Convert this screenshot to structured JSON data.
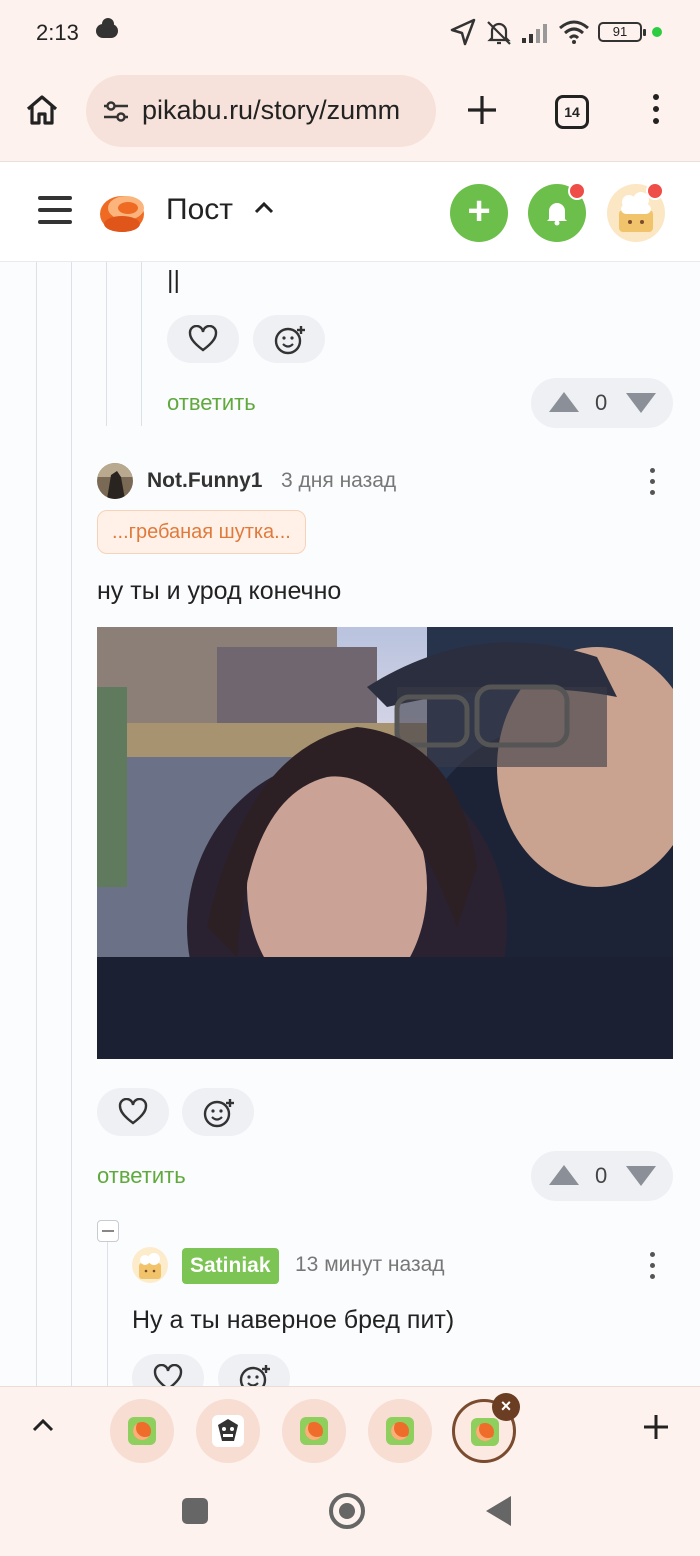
{
  "status_bar": {
    "time": "2:13",
    "battery": "91"
  },
  "browser": {
    "url": "pikabu.ru/story/zumm",
    "tab_count": "14"
  },
  "site_header": {
    "title": "Пост"
  },
  "prev_comment": {
    "text_tail": "||",
    "reply_label": "ответить",
    "rating": "0"
  },
  "comment": {
    "author": "Not.Funny1",
    "time": "3 дня назад",
    "tag": "...гребаная шутка...",
    "text": "ну ты и урод конечно",
    "reply_label": "ответить",
    "rating": "0"
  },
  "reply": {
    "author": "Satiniak",
    "time": "13 минут назад",
    "text": "Ну а ты наверное бред пит)"
  },
  "colors": {
    "accent_green": "#6cbf4a",
    "reply_link": "#5fa93d",
    "tag_text": "#e07a3c",
    "notification_dot": "#ef4d47"
  },
  "icons": [
    "home-icon",
    "tune-icon",
    "plus-icon",
    "tabs-icon",
    "menu-icon",
    "hamburger-icon",
    "pikabu-logo",
    "chevron-up-icon",
    "bell-icon",
    "heart-icon",
    "add-emoji-icon",
    "upvote-icon",
    "downvote-icon",
    "kebab-icon",
    "close-icon"
  ]
}
